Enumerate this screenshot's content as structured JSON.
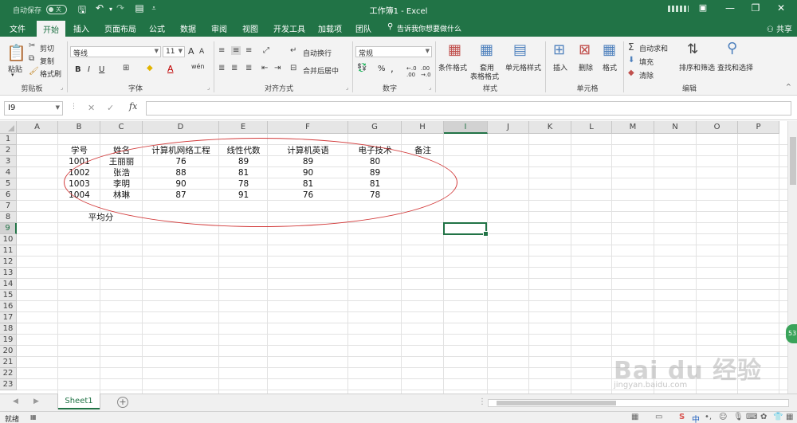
{
  "titlebar": {
    "autosave_label": "自动保存",
    "autosave_state": "关",
    "window_title": "工作簿1  -  Excel",
    "min": "—",
    "restore": "❐",
    "close": "✕",
    "ribbon_toggle": "▣"
  },
  "menu": {
    "tabs": [
      "文件",
      "开始",
      "插入",
      "页面布局",
      "公式",
      "数据",
      "审阅",
      "视图",
      "开发工具",
      "加载项",
      "团队"
    ],
    "active": "开始",
    "tellme": "告诉我你想要做什么",
    "share": "共享"
  },
  "ribbon": {
    "clipboard": {
      "paste": "粘贴",
      "cut": "剪切",
      "copy": "复制",
      "format_painter": "格式刷",
      "label": "剪贴板"
    },
    "font": {
      "name": "等线",
      "size": "11",
      "bold": "B",
      "italic": "I",
      "underline": "U",
      "grow": "A",
      "shrink": "A",
      "wen": "wén",
      "label": "字体"
    },
    "alignment": {
      "wrap": "自动换行",
      "merge": "合并后居中",
      "label": "对齐方式"
    },
    "number": {
      "format": "常规",
      "percent": "%",
      "comma": ",",
      "label": "数字"
    },
    "styles": {
      "conditional": "条件格式",
      "table": "套用",
      "table2": "表格格式",
      "cell": "单元格样式",
      "label": "样式"
    },
    "cells": {
      "insert": "插入",
      "delete": "删除",
      "format": "格式",
      "label": "单元格"
    },
    "editing": {
      "autosum": "自动求和",
      "fill": "填充",
      "clear": "清除",
      "sort": "排序和筛选",
      "find": "查找和选择",
      "label": "编辑"
    }
  },
  "formula_bar": {
    "name_box": "I9",
    "fx": "fx",
    "value": ""
  },
  "grid": {
    "columns": [
      "A",
      "B",
      "C",
      "D",
      "E",
      "F",
      "G",
      "H",
      "I",
      "J",
      "K",
      "L",
      "M",
      "N",
      "O",
      "P"
    ],
    "rows": [
      "1",
      "2",
      "3",
      "4",
      "5",
      "6",
      "7",
      "8",
      "9",
      "10",
      "11",
      "12",
      "13",
      "14",
      "15",
      "16",
      "17",
      "18",
      "19",
      "20",
      "21",
      "22",
      "23"
    ],
    "selected_column": "I",
    "selected_row": "9",
    "headers": [
      "学号",
      "姓名",
      "计算机网络工程",
      "线性代数",
      "计算机英语",
      "电子技术",
      "备注"
    ],
    "records": [
      [
        "1001",
        "王丽丽",
        "76",
        "89",
        "89",
        "80"
      ],
      [
        "1002",
        "张浩",
        "88",
        "81",
        "90",
        "89"
      ],
      [
        "1003",
        "李明",
        "90",
        "78",
        "81",
        "81"
      ],
      [
        "1004",
        "林琳",
        "87",
        "91",
        "76",
        "78"
      ]
    ],
    "average_label": "平均分"
  },
  "sheets": {
    "tabs": [
      "Sheet1"
    ],
    "active": "Sheet1",
    "add": "+"
  },
  "status": {
    "ready": "就绪",
    "ime": "中",
    "zoom_badge": "53"
  },
  "watermark": {
    "main": "Bai du 经验",
    "sub": "jingyan.baidu.com"
  }
}
